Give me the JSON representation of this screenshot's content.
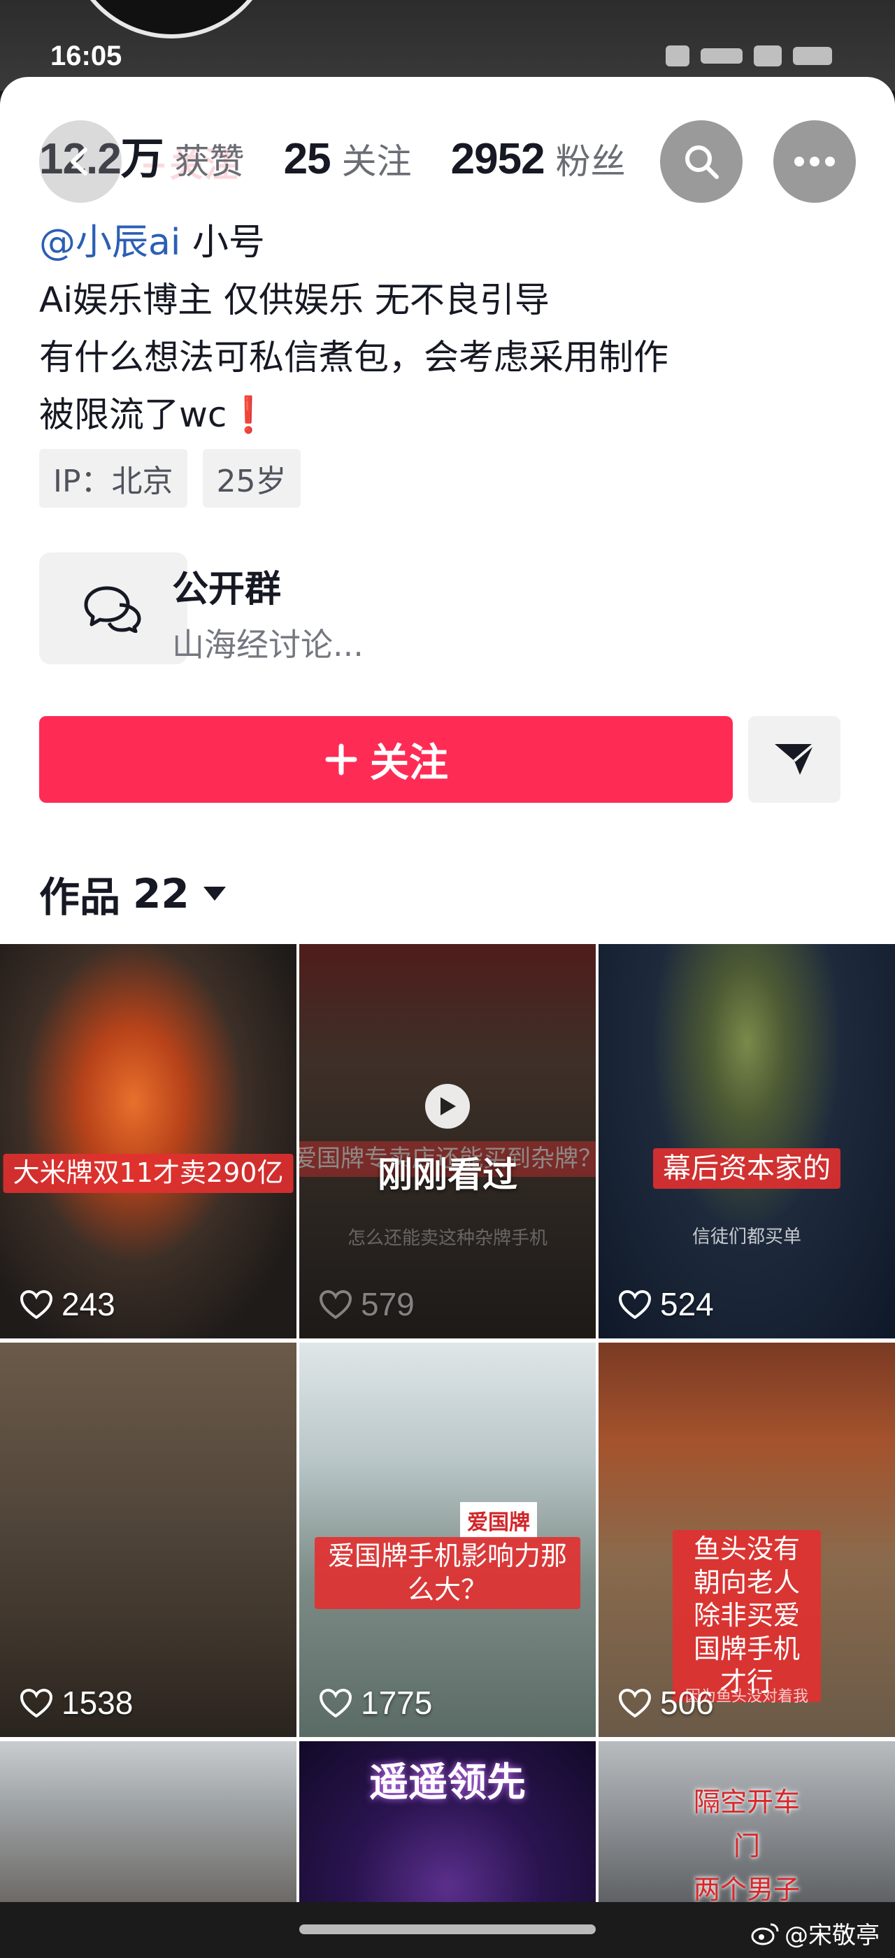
{
  "status": {
    "time": "16:05"
  },
  "profile": {
    "stats": [
      {
        "value": "12.2万",
        "label": "获赞"
      },
      {
        "value": "25",
        "label": "关注"
      },
      {
        "value": "2952",
        "label": "粉丝"
      }
    ],
    "faint_follow": "+关注",
    "handle": "@小辰ai",
    "handle_suffix": "小号",
    "bio_lines": [
      "Ai娱乐博主  仅供娱乐  无不良引导",
      "有什么想法可私信煮包，会考虑采用制作",
      "被限流了wc"
    ],
    "bio_emoji": "❗",
    "tags": [
      "IP：北京",
      "25岁"
    ]
  },
  "group": {
    "title": "公开群",
    "subtitle": "山海经讨论..."
  },
  "actions": {
    "follow_label": "关注"
  },
  "works": {
    "label": "作品",
    "count": "22"
  },
  "videos": [
    {
      "caption": "大米牌双11才卖290亿",
      "likes": "243"
    },
    {
      "caption": "爱国牌专卖店还能买到杂牌？",
      "overlay": "刚刚看过",
      "subtitle": "怎么还能卖这种杂牌手机",
      "likes": "579"
    },
    {
      "caption": "幕后资本家的",
      "subtitle": "信徒们都买单",
      "likes": "524"
    },
    {
      "caption": "",
      "likes": "1538"
    },
    {
      "caption": "爱国牌手机影响力那么大？",
      "sign": "爱国牌",
      "likes": "1775"
    },
    {
      "caption": "鱼头没有朝向老人\n除非买爱国牌手机才行",
      "subtitle": "因为鱼头没对着我",
      "likes": "506"
    },
    {
      "caption": "",
      "likes": ""
    },
    {
      "caption": "遥遥领先",
      "likes": ""
    },
    {
      "caption": "隔空开车门\n两个男子因开车门扭打",
      "likes": ""
    }
  ],
  "watermark": "@宋敬亭",
  "colors": {
    "accent": "#fe2c55",
    "handle": "#2b5fb4",
    "caption_red": "#e23030"
  }
}
